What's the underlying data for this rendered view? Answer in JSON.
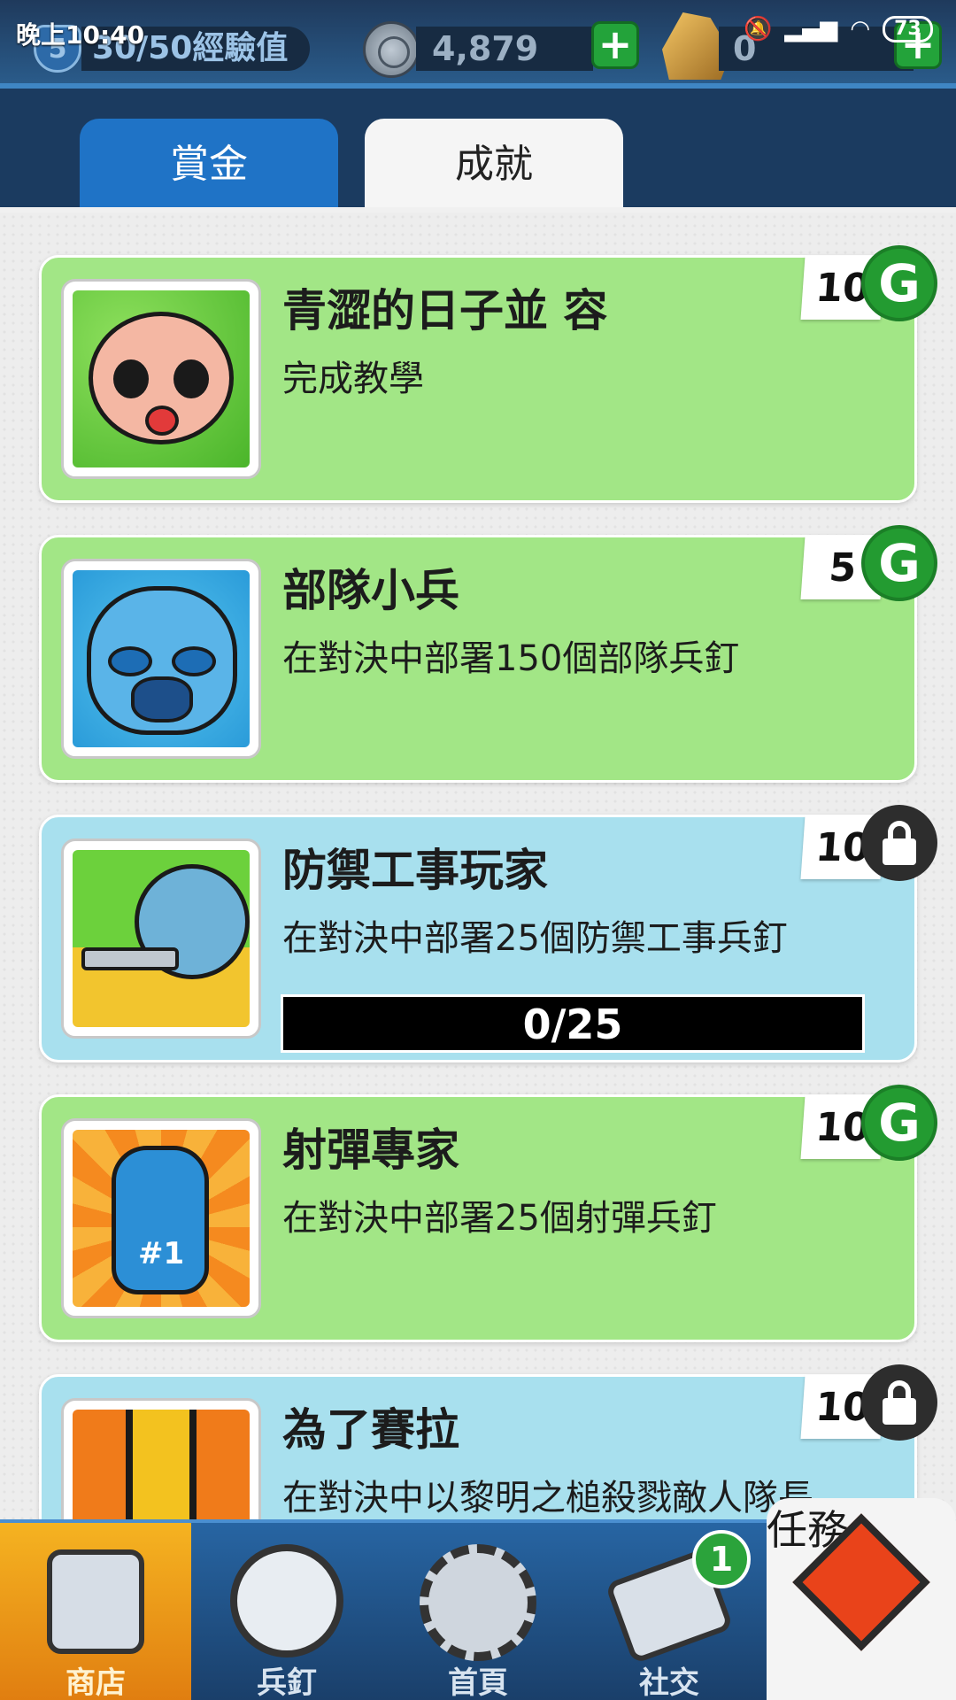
{
  "status_bar": {
    "time": "晚上10:40",
    "battery": "73"
  },
  "header": {
    "level": "5",
    "xp_text": "30/50經驗值",
    "coins": "4,879",
    "gold": "0",
    "plus_symbol": "+"
  },
  "tabs": [
    {
      "label": "賞金",
      "active": false
    },
    {
      "label": "成就",
      "active": true
    }
  ],
  "achievements": [
    {
      "title": "青澀的日子並 容",
      "desc": "完成教學",
      "reward": "10",
      "status": "claimable",
      "icon": "baby-face-icon",
      "color": "green"
    },
    {
      "title": "部隊小兵",
      "desc": "在對決中部署150個部隊兵釘",
      "reward": "5",
      "status": "claimable",
      "icon": "soldier-helmet-icon",
      "color": "green"
    },
    {
      "title": "防禦工事玩家",
      "desc": "在對決中部署25個防禦工事兵釘",
      "reward": "10",
      "status": "locked",
      "icon": "turret-icon",
      "color": "blue",
      "progress": "0/25"
    },
    {
      "title": "射彈專家",
      "desc": "在對決中部署25個射彈兵釘",
      "reward": "10",
      "status": "claimable",
      "icon": "foam-finger-icon",
      "color": "green"
    },
    {
      "title": "為了賽拉",
      "desc": "在對決中以黎明之槌殺戮敵人隊長",
      "reward": "10",
      "status": "locked",
      "icon": "strike-icon",
      "color": "blue"
    }
  ],
  "reward_symbol": "G",
  "bottom_nav": [
    {
      "label": "商店",
      "icon": "shop-icon",
      "active": false
    },
    {
      "label": "兵釘",
      "icon": "pawn-icon",
      "active": false
    },
    {
      "label": "首頁",
      "icon": "home-gear-icon",
      "active": false
    },
    {
      "label": "社交",
      "icon": "chat-icon",
      "active": false,
      "badge": "1"
    },
    {
      "label": "任務",
      "icon": "quests-icon",
      "active": true
    }
  ],
  "colors": {
    "claimable_card": "#a2e686",
    "locked_card": "#a8e0ee",
    "reward_green": "#239b31",
    "header_blue": "#1b3b60"
  }
}
